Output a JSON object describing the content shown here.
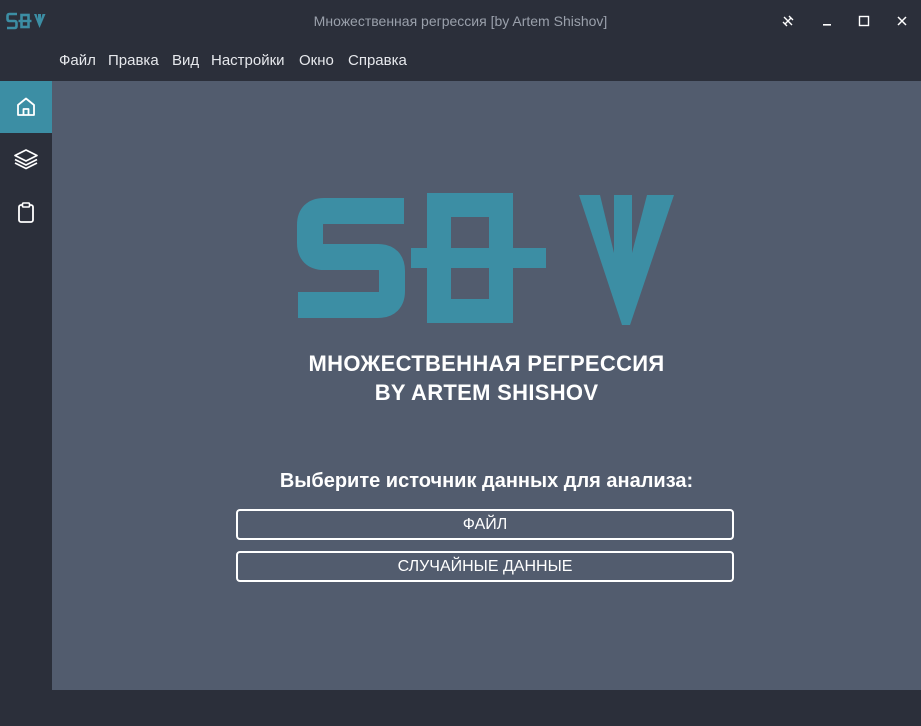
{
  "window": {
    "logo_text": "SEV",
    "title": "Множественная регрессия [by Artem Shishov]"
  },
  "menu": [
    "Файл",
    "Правка",
    "Вид",
    "Настройки",
    "Окно",
    "Справка"
  ],
  "sidebar": {
    "items": [
      {
        "icon": "home-icon",
        "active": true
      },
      {
        "icon": "layers-icon",
        "active": false
      },
      {
        "icon": "clipboard-icon",
        "active": false
      }
    ]
  },
  "main": {
    "logo_text": "SEV",
    "heading_line1": "МНОЖЕСТВЕННАЯ РЕГРЕССИЯ",
    "heading_line2": "BY ARTEM SHISHOV",
    "prompt": "Выберите источник данных для анализа:",
    "buttons": {
      "file": "ФАЙЛ",
      "random": "СЛУЧАЙНЫЕ ДАННЫЕ"
    }
  },
  "colors": {
    "accent": "#3c8ea4",
    "background": "#2b2f3a",
    "panel": "#525c6e",
    "text": "#ffffff"
  }
}
